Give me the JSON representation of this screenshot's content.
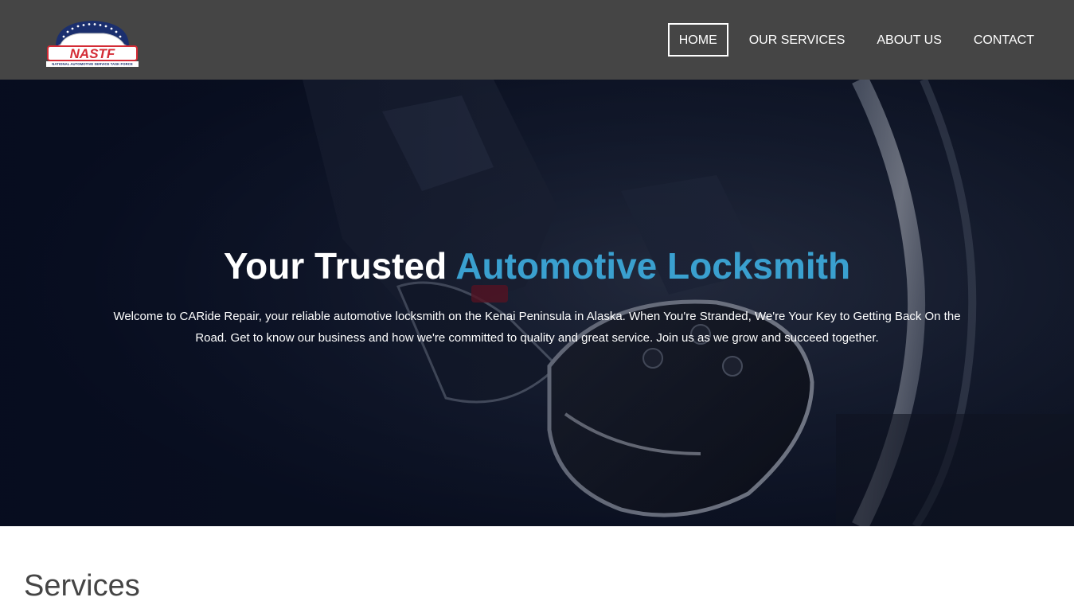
{
  "header": {
    "logo": {
      "text": "NASTF",
      "subtitle": "NATIONAL AUTOMOTIVE SERVICE TASK FORCE"
    },
    "nav": [
      {
        "label": "HOME",
        "active": true
      },
      {
        "label": "OUR SERVICES",
        "active": false
      },
      {
        "label": "ABOUT US",
        "active": false
      },
      {
        "label": "CONTACT",
        "active": false
      }
    ]
  },
  "hero": {
    "title_part1": "Your Trusted ",
    "title_part2": "Automotive Locksmith",
    "text": "Welcome to CARide Repair, your reliable automotive locksmith on the Kenai Peninsula in Alaska. When You're Stranded, We're Your Key to Getting Back On the Road. Get to know our business and how we're committed to quality and great service. Join us as we grow and succeed together."
  },
  "services": {
    "heading": "Services"
  },
  "colors": {
    "header_bg": "#454545",
    "accent": "#3aa0cf",
    "logo_red": "#d42b35",
    "logo_blue": "#1b2f6e"
  }
}
